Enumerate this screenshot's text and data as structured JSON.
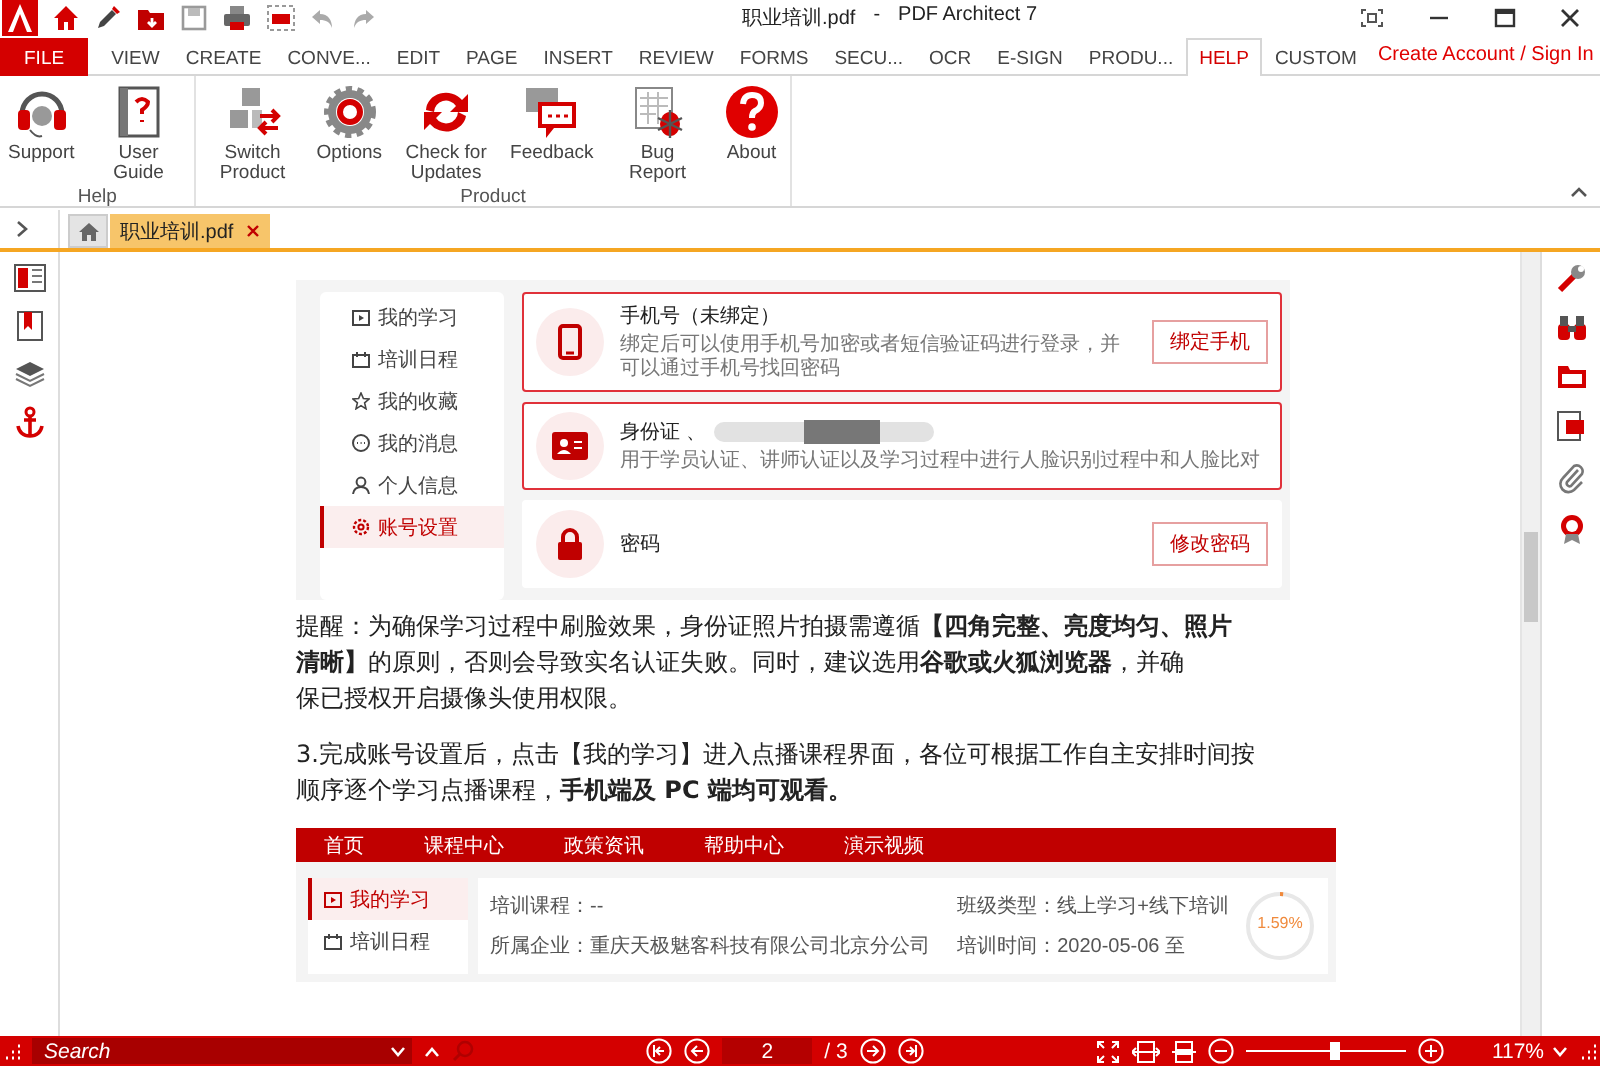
{
  "window": {
    "title": "职业培训.pdf",
    "separator": "-",
    "app": "PDF Architect 7"
  },
  "menu_tabs": [
    {
      "label": "FILE",
      "kind": "file",
      "selected": false
    },
    {
      "label": "VIEW",
      "kind": "tab",
      "selected": false
    },
    {
      "label": "CREATE",
      "kind": "tab",
      "selected": false
    },
    {
      "label": "CONVE...",
      "kind": "tab",
      "selected": false
    },
    {
      "label": "EDIT",
      "kind": "tab",
      "selected": false
    },
    {
      "label": "PAGE",
      "kind": "tab",
      "selected": false
    },
    {
      "label": "INSERT",
      "kind": "tab",
      "selected": false
    },
    {
      "label": "REVIEW",
      "kind": "tab",
      "selected": false
    },
    {
      "label": "FORMS",
      "kind": "tab",
      "selected": false
    },
    {
      "label": "SECU...",
      "kind": "tab",
      "selected": false
    },
    {
      "label": "OCR",
      "kind": "tab",
      "selected": false
    },
    {
      "label": "E-SIGN",
      "kind": "tab",
      "selected": false
    },
    {
      "label": "PRODU...",
      "kind": "tab",
      "selected": false
    },
    {
      "label": "HELP",
      "kind": "tab",
      "selected": true
    },
    {
      "label": "CUSTOM",
      "kind": "tab",
      "selected": false
    }
  ],
  "account_link": "Create Account / Sign In",
  "ribbon_groups": [
    {
      "label": "Help",
      "buttons": [
        {
          "label": "Support",
          "kind": "headset"
        },
        {
          "label": "User Guide",
          "kind": "guide"
        }
      ]
    },
    {
      "label": "Product",
      "buttons": [
        {
          "label": "Switch Product",
          "kind": "switch"
        },
        {
          "label": "Options",
          "kind": "gear"
        },
        {
          "label": "Check for Updates",
          "kind": "refresh"
        },
        {
          "label": "Feedback",
          "kind": "chat"
        },
        {
          "label": "Bug Report",
          "kind": "bug"
        },
        {
          "label": "About",
          "kind": "question"
        }
      ]
    }
  ],
  "document_tabs": [
    {
      "label": "职业培训.pdf",
      "selected": true
    }
  ],
  "document": {
    "shot1": {
      "menu": [
        {
          "label": "我的学习",
          "kind": "play",
          "selected": false
        },
        {
          "label": "培训日程",
          "kind": "calendar",
          "selected": false
        },
        {
          "label": "我的收藏",
          "kind": "star",
          "selected": false
        },
        {
          "label": "我的消息",
          "kind": "message",
          "selected": false
        },
        {
          "label": "个人信息",
          "kind": "person",
          "selected": false
        },
        {
          "label": "账号设置",
          "kind": "gear",
          "selected": true
        }
      ],
      "cards": [
        {
          "kind": "phone",
          "title": "手机号（未绑定）",
          "description": "绑定后可以使用手机号加密或者短信验证码进行登录，并可以通过手机号找回密码",
          "button": "绑定手机",
          "highlighted": true
        },
        {
          "kind": "id",
          "title": "身份证 、",
          "redacted": true,
          "description": "用于学员认证、讲师认证以及学习过程中进行人脸识别过程中和人脸比对",
          "highlighted": true
        },
        {
          "kind": "lock",
          "title": "密码",
          "button": "修改密码",
          "highlighted": false
        }
      ]
    },
    "paragraphs": [
      {
        "lines": [
          "提醒：为确保学习过程中刷脸效果，身份证照片拍摄需遵循**【四角完整、亮度均匀、照片**",
          "**清晰】**的原则，否则会导致实名认证失败。同时，建议选用**谷歌或火狐浏览器**，并确",
          "保已授权开启摄像头使用权限。"
        ]
      },
      {
        "lines": [
          "3.完成账号设置后，点击【我的学习】进入点播课程界面，各位可根据工作自主安排时间按",
          "顺序逐个学习点播课程，**手机端及 PC 端均可观看。**"
        ]
      }
    ],
    "shot2": {
      "nav": [
        "首页",
        "课程中心",
        "政策资讯",
        "帮助中心",
        "演示视频"
      ],
      "menu": [
        {
          "label": "我的学习",
          "kind": "play",
          "selected": true
        },
        {
          "label": "培训日程",
          "kind": "calendar",
          "selected": false
        }
      ],
      "info": [
        "培训课程：--",
        "班级类型：线上学习+线下培训",
        "所属企业：重庆天极魅客科技有限公司北京分公司",
        "培训时间：2020-05-06 至"
      ],
      "progress": {
        "label": "1.59%",
        "level": 0.0159
      }
    }
  },
  "status_bar": {
    "search_placeholder": "Search",
    "page": "2",
    "page_total": "/ 3",
    "zoom": "117%",
    "zoom_slider": {
      "level": 0.55
    }
  }
}
